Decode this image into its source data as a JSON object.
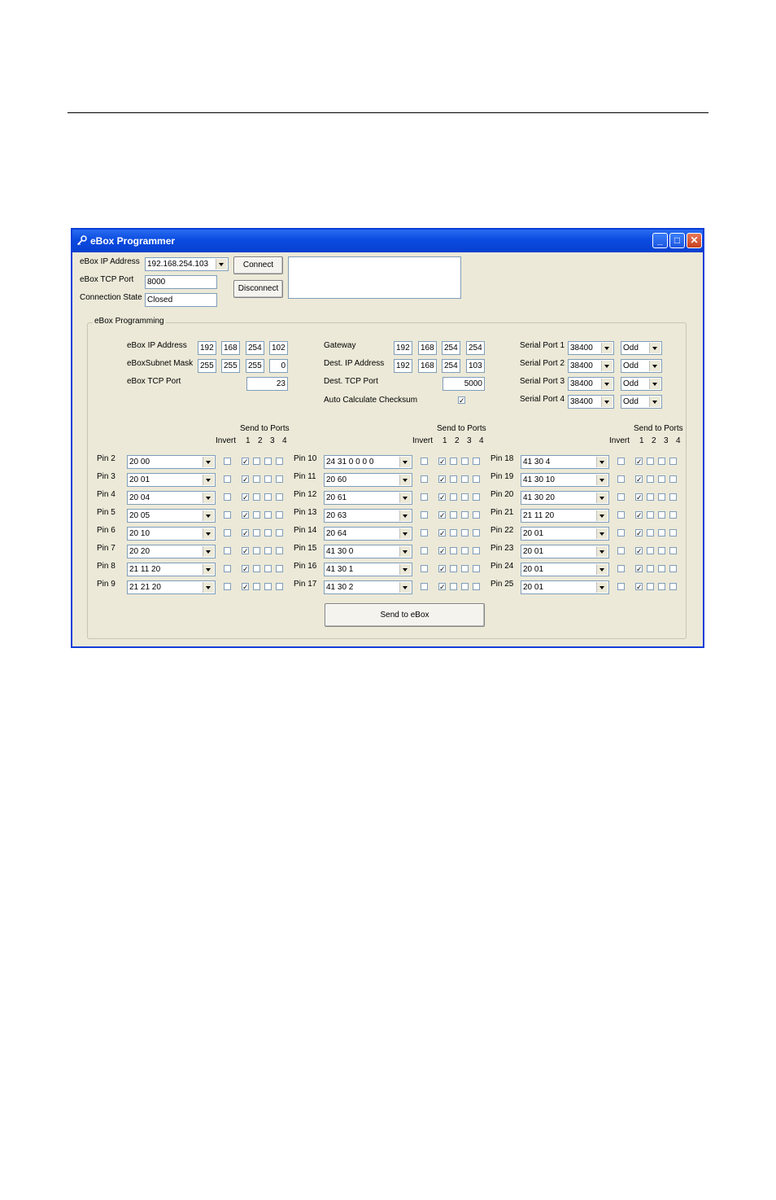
{
  "window": {
    "title": "eBox Programmer"
  },
  "connection": {
    "ip_label": "eBox IP Address",
    "ip_value": "192.168.254.103",
    "port_label": "eBox TCP Port",
    "port_value": "8000",
    "state_label": "Connection State",
    "state_value": "Closed",
    "connect_label": "Connect",
    "disconnect_label": "Disconnect",
    "message_text": ""
  },
  "programming": {
    "group_label": "eBox Programming",
    "ebox_ip_label": "eBox IP Address",
    "ebox_ip": [
      "192",
      "168",
      "254",
      "102"
    ],
    "subnet_label": "eBoxSubnet Mask",
    "subnet": [
      "255",
      "255",
      "255",
      "0"
    ],
    "tcp_port_label": "eBox TCP Port",
    "tcp_port": "23",
    "gateway_label": "Gateway",
    "gateway": [
      "192",
      "168",
      "254",
      "254"
    ],
    "dest_ip_label": "Dest. IP Address",
    "dest_ip": [
      "192",
      "168",
      "254",
      "103"
    ],
    "dest_port_label": "Dest. TCP Port",
    "dest_port": "5000",
    "checksum_label": "Auto Calculate Checksum",
    "checksum_checked": true,
    "serial_ports": [
      {
        "label": "Serial Port 1",
        "baud": "38400",
        "parity": "Odd"
      },
      {
        "label": "Serial Port 2",
        "baud": "38400",
        "parity": "Odd"
      },
      {
        "label": "Serial Port 3",
        "baud": "38400",
        "parity": "Odd"
      },
      {
        "label": "Serial Port 4",
        "baud": "38400",
        "parity": "Odd"
      }
    ],
    "pin_columns": [
      {
        "header_send": "Send to Ports",
        "header_invert": "Invert",
        "ports": [
          "1",
          "2",
          "3",
          "4"
        ],
        "pins": [
          {
            "label": "Pin 2",
            "value": "20 00",
            "invert": false,
            "ports": [
              true,
              false,
              false,
              false
            ]
          },
          {
            "label": "Pin 3",
            "value": "20 01",
            "invert": false,
            "ports": [
              true,
              false,
              false,
              false
            ]
          },
          {
            "label": "Pin 4",
            "value": "20 04",
            "invert": false,
            "ports": [
              true,
              false,
              false,
              false
            ]
          },
          {
            "label": "Pin 5",
            "value": "20 05",
            "invert": false,
            "ports": [
              true,
              false,
              false,
              false
            ]
          },
          {
            "label": "Pin 6",
            "value": "20 10",
            "invert": false,
            "ports": [
              true,
              false,
              false,
              false
            ]
          },
          {
            "label": "Pin 7",
            "value": "20 20",
            "invert": false,
            "ports": [
              true,
              false,
              false,
              false
            ]
          },
          {
            "label": "Pin 8",
            "value": "21 11 20",
            "invert": false,
            "ports": [
              true,
              false,
              false,
              false
            ]
          },
          {
            "label": "Pin 9",
            "value": "21 21 20",
            "invert": false,
            "ports": [
              true,
              false,
              false,
              false
            ]
          }
        ]
      },
      {
        "header_send": "Send to Ports",
        "header_invert": "Invert",
        "ports": [
          "1",
          "2",
          "3",
          "4"
        ],
        "pins": [
          {
            "label": "Pin 10",
            "value": "24 31 0 0 0 0",
            "invert": false,
            "ports": [
              true,
              false,
              false,
              false
            ]
          },
          {
            "label": "Pin 11",
            "value": "20 60",
            "invert": false,
            "ports": [
              true,
              false,
              false,
              false
            ]
          },
          {
            "label": "Pin 12",
            "value": "20 61",
            "invert": false,
            "ports": [
              true,
              false,
              false,
              false
            ]
          },
          {
            "label": "Pin 13",
            "value": "20 63",
            "invert": false,
            "ports": [
              true,
              false,
              false,
              false
            ]
          },
          {
            "label": "Pin 14",
            "value": "20 64",
            "invert": false,
            "ports": [
              true,
              false,
              false,
              false
            ]
          },
          {
            "label": "Pin 15",
            "value": "41 30 0",
            "invert": false,
            "ports": [
              true,
              false,
              false,
              false
            ]
          },
          {
            "label": "Pin 16",
            "value": "41 30 1",
            "invert": false,
            "ports": [
              true,
              false,
              false,
              false
            ]
          },
          {
            "label": "Pin 17",
            "value": "41 30 2",
            "invert": false,
            "ports": [
              true,
              false,
              false,
              false
            ]
          }
        ]
      },
      {
        "header_send": "Send to Ports",
        "header_invert": "Invert",
        "ports": [
          "1",
          "2",
          "3",
          "4"
        ],
        "pins": [
          {
            "label": "Pin 18",
            "value": "41 30 4",
            "invert": false,
            "ports": [
              true,
              false,
              false,
              false
            ]
          },
          {
            "label": "Pin 19",
            "value": "41 30 10",
            "invert": false,
            "ports": [
              true,
              false,
              false,
              false
            ]
          },
          {
            "label": "Pin 20",
            "value": "41 30 20",
            "invert": false,
            "ports": [
              true,
              false,
              false,
              false
            ]
          },
          {
            "label": "Pin 21",
            "value": "21 11 20",
            "invert": false,
            "ports": [
              true,
              false,
              false,
              false
            ]
          },
          {
            "label": "Pin 22",
            "value": "20 01",
            "invert": false,
            "ports": [
              true,
              false,
              false,
              false
            ]
          },
          {
            "label": "Pin 23",
            "value": "20 01",
            "invert": false,
            "ports": [
              true,
              false,
              false,
              false
            ]
          },
          {
            "label": "Pin 24",
            "value": "20 01",
            "invert": false,
            "ports": [
              true,
              false,
              false,
              false
            ]
          },
          {
            "label": "Pin 25",
            "value": "20 01",
            "invert": false,
            "ports": [
              true,
              false,
              false,
              false
            ]
          }
        ]
      }
    ],
    "send_label": "Send to eBox"
  }
}
